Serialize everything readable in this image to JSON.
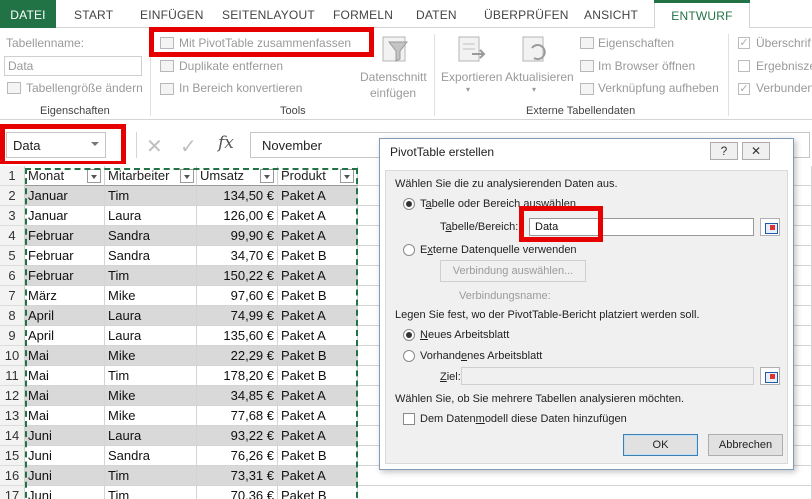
{
  "ribbon_tabs": [
    {
      "label": "DATEI"
    },
    {
      "label": "START"
    },
    {
      "label": "EINFÜGEN"
    },
    {
      "label": "SEITENLAYOUT"
    },
    {
      "label": "FORMELN"
    },
    {
      "label": "DATEN"
    },
    {
      "label": "ÜBERPRÜFEN"
    },
    {
      "label": "ANSICHT"
    },
    {
      "label": "ENTWURF"
    }
  ],
  "ribbon": {
    "eigenschaften": {
      "tabellenname_label": "Tabellenname:",
      "tabellenname_value": "Data",
      "resize_label": "Tabellengröße ändern",
      "group_label": "Eigenschaften"
    },
    "tools": {
      "pivot_label": "Mit PivotTable zusammenfassen",
      "duplikate_label": "Duplikate entfernen",
      "bereich_label": "In Bereich konvertieren",
      "datenschnitt_line1": "Datenschnitt",
      "datenschnitt_line2": "einfügen",
      "group_label": "Tools"
    },
    "externe": {
      "exportieren_label": "Exportieren",
      "aktualisieren_label": "Aktualisieren",
      "eigenschaften_label": "Eigenschaften",
      "browser_label": "Im Browser öffnen",
      "verknuepfung_label": "Verknüpfung aufheben",
      "group_label": "Externe Tabellendaten"
    },
    "optionen": {
      "ueberschrift_label": "Überschrif",
      "ergebnis_label": "Ergebniszei",
      "verbunden_label": "Verbunden"
    }
  },
  "formula_bar": {
    "name_box": "Data",
    "formula": "November"
  },
  "sheet": {
    "columns": [
      "Monat",
      "Mitarbeiter",
      "Umsatz",
      "Produkt"
    ],
    "rows": [
      {
        "n": "2",
        "monat": "Januar",
        "mitarbeiter": "Tim",
        "umsatz": "134,50 €",
        "produkt": "Paket A"
      },
      {
        "n": "3",
        "monat": "Januar",
        "mitarbeiter": "Laura",
        "umsatz": "126,00 €",
        "produkt": "Paket A"
      },
      {
        "n": "4",
        "monat": "Februar",
        "mitarbeiter": "Sandra",
        "umsatz": "99,90 €",
        "produkt": "Paket A"
      },
      {
        "n": "5",
        "monat": "Februar",
        "mitarbeiter": "Sandra",
        "umsatz": "34,70 €",
        "produkt": "Paket B"
      },
      {
        "n": "6",
        "monat": "Februar",
        "mitarbeiter": "Tim",
        "umsatz": "150,22 €",
        "produkt": "Paket A"
      },
      {
        "n": "7",
        "monat": "März",
        "mitarbeiter": "Mike",
        "umsatz": "97,60 €",
        "produkt": "Paket B"
      },
      {
        "n": "8",
        "monat": "April",
        "mitarbeiter": "Laura",
        "umsatz": "74,99 €",
        "produkt": "Paket A"
      },
      {
        "n": "9",
        "monat": "April",
        "mitarbeiter": "Laura",
        "umsatz": "135,60 €",
        "produkt": "Paket A"
      },
      {
        "n": "10",
        "monat": "Mai",
        "mitarbeiter": "Mike",
        "umsatz": "22,29 €",
        "produkt": "Paket B"
      },
      {
        "n": "11",
        "monat": "Mai",
        "mitarbeiter": "Tim",
        "umsatz": "178,20 €",
        "produkt": "Paket B"
      },
      {
        "n": "12",
        "monat": "Mai",
        "mitarbeiter": "Mike",
        "umsatz": "34,85 €",
        "produkt": "Paket A"
      },
      {
        "n": "13",
        "monat": "Mai",
        "mitarbeiter": "Mike",
        "umsatz": "77,68 €",
        "produkt": "Paket A"
      },
      {
        "n": "14",
        "monat": "Juni",
        "mitarbeiter": "Laura",
        "umsatz": "93,22 €",
        "produkt": "Paket A"
      },
      {
        "n": "15",
        "monat": "Juni",
        "mitarbeiter": "Sandra",
        "umsatz": "76,26 €",
        "produkt": "Paket B"
      },
      {
        "n": "16",
        "monat": "Juni",
        "mitarbeiter": "Tim",
        "umsatz": "73,31 €",
        "produkt": "Paket A"
      },
      {
        "n": "17",
        "monat": "Juni",
        "mitarbeiter": "Tim",
        "umsatz": "70,36 €",
        "produkt": "Paket B"
      }
    ]
  },
  "dialog": {
    "title": "PivotTable erstellen",
    "help_label": "?",
    "close_label": "✕",
    "section1": "Wählen Sie die zu analysierenden Daten aus.",
    "opt_range_pre": "T",
    "opt_range_u": "a",
    "opt_range_post": "belle oder Bereich auswählen",
    "range_label_pre": "T",
    "range_label_u": "a",
    "range_label_post": "belle/Bereich:",
    "range_value": "Data",
    "opt_external_pre": "E",
    "opt_external_u": "x",
    "opt_external_post": "terne Datenquelle verwenden",
    "btn_connection": "Verbindung auswählen...",
    "connection_name_label": "Verbindungsname:",
    "section2": "Legen Sie fest, wo der PivotTable-Bericht platziert werden soll.",
    "opt_new_pre": "",
    "opt_new_u": "N",
    "opt_new_post": "eues Arbeitsblatt",
    "opt_existing_pre": "Vorhand",
    "opt_existing_u": "e",
    "opt_existing_post": "nes Arbeitsblatt",
    "ziel_pre": "",
    "ziel_u": "Z",
    "ziel_post": "iel:",
    "ziel_value": "",
    "section3": "Wählen Sie, ob Sie mehrere Tabellen analysieren möchten.",
    "datamodel_pre": "Dem Daten",
    "datamodel_u": "m",
    "datamodel_post": "odell diese Daten hinzufügen",
    "ok_label": "OK",
    "cancel_label": "Abbrechen"
  },
  "colors": {
    "excel_green": "#217346",
    "highlight_red": "#e60000",
    "band_gray": "#d9d9d9"
  },
  "icons": [
    "pivot-table-icon",
    "remove-duplicates-icon",
    "convert-range-icon",
    "table-resize-icon",
    "slicer-icon",
    "export-icon",
    "refresh-icon",
    "properties-icon",
    "browser-icon",
    "unlink-icon",
    "cancel-x-icon",
    "confirm-check-icon",
    "function-icon",
    "help-icon",
    "close-icon",
    "range-select-icon"
  ]
}
